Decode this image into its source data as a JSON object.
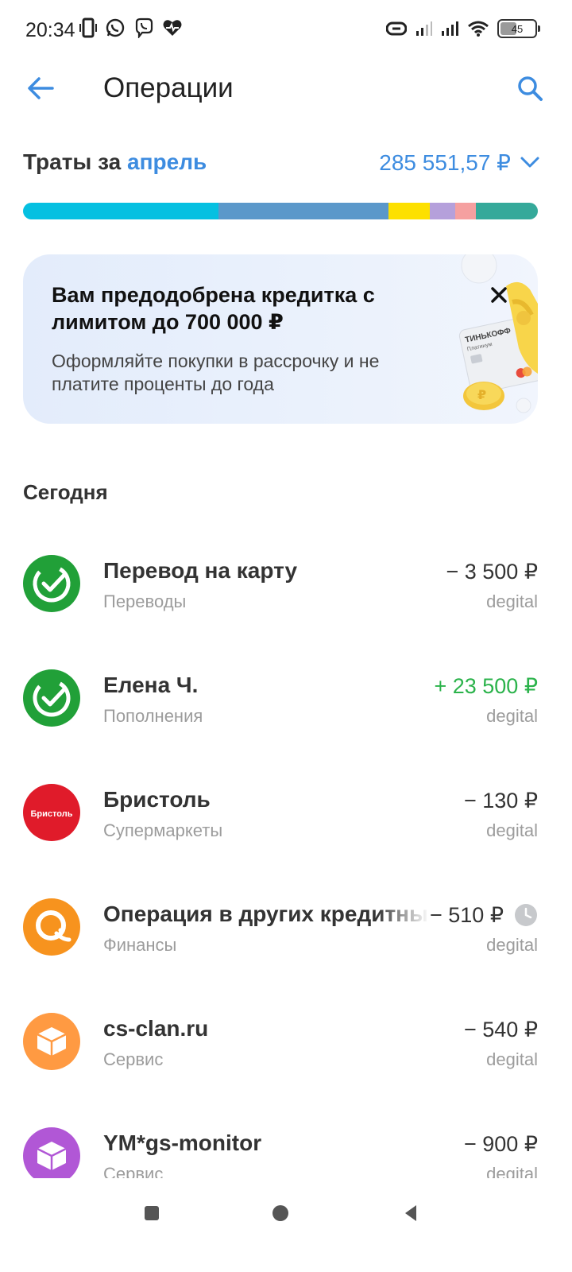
{
  "status_bar": {
    "time": "20:34",
    "battery": "45"
  },
  "header": {
    "title": "Операции"
  },
  "spending": {
    "label_prefix": "Траты за",
    "month": "апрель",
    "total": "285 551,57 ₽",
    "segments": [
      {
        "color": "#05c0e1",
        "share": 0.38
      },
      {
        "color": "#5b98ca",
        "share": 0.33
      },
      {
        "color": "#fde000",
        "share": 0.08
      },
      {
        "color": "#b5a0db",
        "share": 0.05
      },
      {
        "color": "#f5a0a0",
        "share": 0.04
      },
      {
        "color": "#35a99a",
        "share": 0.12
      }
    ]
  },
  "promo": {
    "title": "Вам предодобрена кредитка с лимитом до 700 000 ₽",
    "text": "Оформляйте покупки в рассрочку и не платите проценты до года",
    "card_brand": "ТИНЬКОФФ",
    "card_tier": "Платинум"
  },
  "section": {
    "today": "Сегодня"
  },
  "operations": [
    {
      "title": "Перевод на карту",
      "category": "Переводы",
      "amount": "− 3 500 ₽",
      "account": "degital",
      "positive": false,
      "icon": "check-circle-icon",
      "color": "#21a038"
    },
    {
      "title": "Елена Ч.",
      "category": "Пополнения",
      "amount": "+ 23 500 ₽",
      "account": "degital",
      "positive": true,
      "icon": "check-circle-icon",
      "color": "#21a038"
    },
    {
      "title": "Бристоль",
      "category": "Супермаркеты",
      "amount": "− 130 ₽",
      "account": "degital",
      "positive": false,
      "icon": "bristol-logo",
      "logo_text": "Бристоль",
      "color": "#e01b2a"
    },
    {
      "title": "Операция в других кредитных",
      "category": "Финансы",
      "amount": "− 510 ₽",
      "account": "degital",
      "positive": false,
      "icon": "qiwi-logo",
      "color": "#f7931e",
      "pending": true
    },
    {
      "title": "cs-clan.ru",
      "category": "Сервис",
      "amount": "− 540 ₽",
      "account": "degital",
      "positive": false,
      "icon": "box-icon",
      "color": "#ff9a42"
    },
    {
      "title": "YM*gs-monitor",
      "category": "Сервис",
      "amount": "− 900 ₽",
      "account": "degital",
      "positive": false,
      "icon": "box-icon",
      "color": "#b157d6"
    }
  ],
  "colors": {
    "accent": "#3d8ce0",
    "positive": "#2bb34b",
    "muted": "#9c9c9c"
  }
}
